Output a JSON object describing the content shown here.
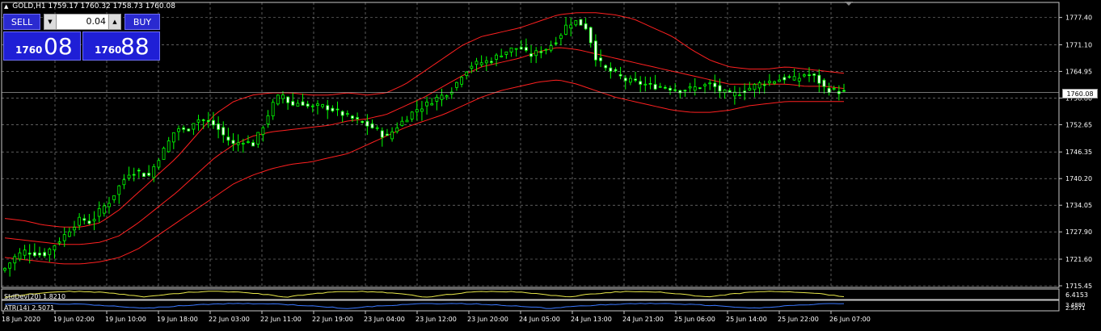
{
  "header": {
    "symbol_line": "GOLD,H1  1759.17 1760.32 1758.73 1760.08"
  },
  "trade_panel": {
    "sell_label": "SELL",
    "buy_label": "BUY",
    "lot_value": "0.04",
    "sell_price_small": "1760",
    "sell_price_big": "08",
    "buy_price_small": "1760",
    "buy_price_big": "88"
  },
  "current_price_label": "1760.08",
  "indicators": {
    "stddev_label": "StdDev(20) 1.8210",
    "atr_label": "ATR(14) 2.5071",
    "stddev_scale": "6.4153",
    "atr_scale_top": "3.4880",
    "atr_scale_bottom": "2.5071"
  },
  "colors": {
    "background": "#000000",
    "grid": "#c8c8c8",
    "bull_candle": "#00ff00",
    "bear_candle": "#ffffff",
    "bollinger": "#ff2020",
    "stddev_line": "#e8e84a",
    "atr_line": "#3a78ff"
  },
  "chart_data": {
    "type": "candlestick",
    "y_ticks": [
      "1777.40",
      "1771.10",
      "1764.95",
      "1758.80",
      "1752.65",
      "1746.35",
      "1740.20",
      "1734.05",
      "1727.90",
      "1721.60",
      "1715.45"
    ],
    "ylim": [
      1715.45,
      1780.5
    ],
    "x_ticks": [
      "18 Jun 2020",
      "19 Jun 02:00",
      "19 Jun 10:00",
      "19 Jun 18:00",
      "22 Jun 03:00",
      "22 Jun 11:00",
      "22 Jun 19:00",
      "23 Jun 04:00",
      "23 Jun 12:00",
      "23 Jun 20:00",
      "24 Jun 05:00",
      "24 Jun 13:00",
      "24 Jun 21:00",
      "25 Jun 06:00",
      "25 Jun 14:00",
      "25 Jun 22:00",
      "26 Jun 07:00"
    ],
    "close_anchors": [
      1719.5,
      1722,
      1723.5,
      1723.0,
      1722.5,
      1724.5,
      1726.5,
      1729,
      1731,
      1730,
      1733,
      1735,
      1738.5,
      1741.5,
      1742,
      1740.5,
      1744.5,
      1748,
      1752,
      1751,
      1754,
      1753.5,
      1752.5,
      1750,
      1748,
      1749,
      1748,
      1752,
      1757,
      1760,
      1757,
      1758,
      1756.5,
      1757,
      1756.5,
      1755.5,
      1754.5,
      1753.5,
      1752.5,
      1751.5,
      1749.5,
      1752,
      1754,
      1756,
      1757,
      1758.5,
      1759.5,
      1761,
      1764.5,
      1766.5,
      1767,
      1767.5,
      1769,
      1770,
      1770.5,
      1768.5,
      1769.5,
      1770.5,
      1772.5,
      1776,
      1776.5,
      1775,
      1768,
      1765.5,
      1764.5,
      1763,
      1762.5,
      1762,
      1761.5,
      1761.5,
      1761,
      1760.5,
      1761,
      1761.5,
      1762,
      1760.5,
      1759.5,
      1760,
      1761,
      1762,
      1762.5,
      1763,
      1763.5,
      1763,
      1764.5,
      1763.5,
      1761,
      1760.5,
      1760.1
    ],
    "bollinger_upper_anchors": [
      1731,
      1730.5,
      1729.5,
      1729,
      1729,
      1730,
      1733,
      1737,
      1741,
      1745,
      1750,
      1755,
      1758,
      1759.5,
      1760,
      1760,
      1759.5,
      1759.5,
      1760,
      1759.5,
      1760,
      1762,
      1765,
      1768,
      1771,
      1773,
      1774,
      1775,
      1776.5,
      1778,
      1778.5,
      1778.5,
      1778,
      1777,
      1775,
      1773,
      1770,
      1767.5,
      1766,
      1765.5,
      1765.5,
      1766,
      1765.5,
      1765,
      1764.5
    ],
    "bollinger_middle_anchors": [
      1726.5,
      1726,
      1725.5,
      1725,
      1725,
      1725.5,
      1727,
      1730,
      1733.5,
      1737,
      1741,
      1745,
      1748,
      1750,
      1751,
      1751.5,
      1752,
      1752.5,
      1753.5,
      1754,
      1755,
      1757,
      1759,
      1761.5,
      1764,
      1766,
      1767,
      1768,
      1769.5,
      1770.5,
      1770,
      1769,
      1768,
      1767,
      1766,
      1765,
      1764,
      1763,
      1762,
      1762,
      1762,
      1762,
      1761.5,
      1761.5,
      1761
    ],
    "bollinger_lower_anchors": [
      1722,
      1721.5,
      1721,
      1720.5,
      1720.5,
      1721,
      1722,
      1724,
      1727,
      1730,
      1733,
      1736,
      1739,
      1741,
      1742.5,
      1743.5,
      1744,
      1745,
      1746,
      1748,
      1750,
      1752,
      1753.5,
      1755,
      1757,
      1759,
      1760.5,
      1761.5,
      1762.5,
      1763,
      1762,
      1760.5,
      1759,
      1758,
      1757,
      1756,
      1755.5,
      1755.5,
      1756,
      1757,
      1757.5,
      1758,
      1758,
      1758,
      1758
    ]
  }
}
